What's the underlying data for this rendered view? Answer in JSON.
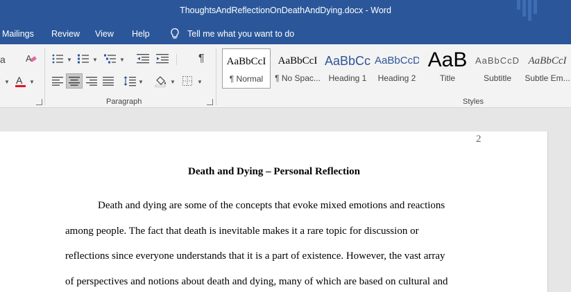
{
  "titlebar": {
    "title": "ThoughtsAndReflectionOnDeathAndDying.docx  -  Word"
  },
  "menu": {
    "items": [
      "Mailings",
      "Review",
      "View",
      "Help"
    ],
    "tell_me": "Tell me what you want to do"
  },
  "ribbon": {
    "paragraph_label": "Paragraph",
    "styles_label": "Styles",
    "styles": [
      {
        "preview": "AaBbCcI",
        "label": "¶ Normal"
      },
      {
        "preview": "AaBbCcI",
        "label": "¶ No Spac..."
      },
      {
        "preview": "AaBbCc",
        "label": "Heading 1"
      },
      {
        "preview": "AaBbCcD",
        "label": "Heading 2"
      },
      {
        "preview": "AaB",
        "label": "Title"
      },
      {
        "preview": "AaBbCcD",
        "label": "Subtitle"
      },
      {
        "preview": "AaBbCcI",
        "label": "Subtle Em..."
      }
    ],
    "icons": {
      "partial_a": "a",
      "pilcrow": "¶"
    },
    "colors": {
      "font_color_bar": "#e81123",
      "accent": "#2b579a",
      "heading_style": "#2f5496"
    }
  },
  "document": {
    "page_number": "2",
    "heading": "Death and Dying – Personal Reflection",
    "lines": [
      "Death and dying are some of the concepts that evoke mixed emotions and reactions",
      "among people. The fact that death is inevitable makes it a rare topic for discussion or",
      "reflections since everyone understands that it is a part of existence. However, the vast array",
      "of perspectives and notions about death and dying, many of which are based on cultural and"
    ]
  }
}
